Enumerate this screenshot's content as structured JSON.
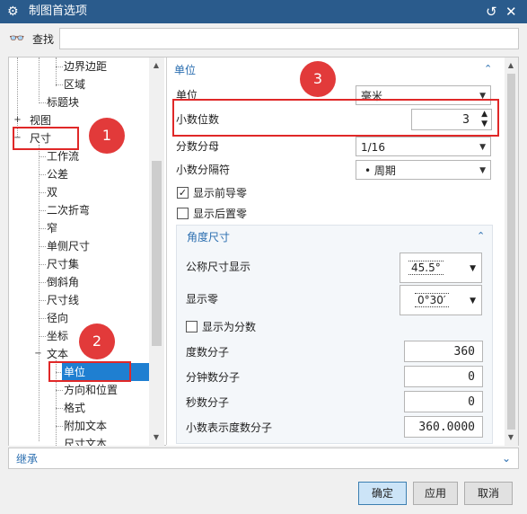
{
  "window": {
    "title": "制图首选项",
    "gear_icon": "gear-icon",
    "reset_icon": "reset-icon",
    "close_icon": "close-icon"
  },
  "find": {
    "label": "查找",
    "value": "",
    "placeholder": ""
  },
  "tree": {
    "items": [
      {
        "label": "边界边距"
      },
      {
        "label": "区域"
      },
      {
        "label": "标题块"
      },
      {
        "label": "视图"
      },
      {
        "label": "尺寸"
      },
      {
        "label": "工作流"
      },
      {
        "label": "公差"
      },
      {
        "label": "双"
      },
      {
        "label": "二次折弯"
      },
      {
        "label": "窄"
      },
      {
        "label": "单侧尺寸"
      },
      {
        "label": "尺寸集"
      },
      {
        "label": "倒斜角"
      },
      {
        "label": "尺寸线"
      },
      {
        "label": "径向"
      },
      {
        "label": "坐标"
      },
      {
        "label": "文本"
      },
      {
        "label": "单位"
      },
      {
        "label": "方向和位置"
      },
      {
        "label": "格式"
      },
      {
        "label": "附加文本"
      },
      {
        "label": "尺寸文本"
      }
    ]
  },
  "units_section": {
    "header": "单位",
    "unit_label": "单位",
    "unit_value": "毫米",
    "decimal_places_label": "小数位数",
    "decimal_places_value": "3",
    "fraction_denominator_label": "分数分母",
    "fraction_denominator_value": "1/16",
    "decimal_separator_label": "小数分隔符",
    "decimal_separator_value": "• 周期",
    "show_leading_zeros_label": "显示前导零",
    "show_leading_zeros_checked": true,
    "show_trailing_zeros_label": "显示后置零",
    "show_trailing_zeros_checked": false
  },
  "angle_section": {
    "header": "角度尺寸",
    "nominal_display_label": "公称尺寸显示",
    "nominal_display_value": "45.5°",
    "show_zero_label": "显示零",
    "show_zero_value": "0°30′",
    "show_as_fraction_label": "显示为分数",
    "show_as_fraction_checked": false,
    "degrees_numerator_label": "度数分子",
    "degrees_numerator_value": "360",
    "minutes_numerator_label": "分钟数分子",
    "minutes_numerator_value": "0",
    "seconds_numerator_label": "秒数分子",
    "seconds_numerator_value": "0",
    "decimal_degrees_numerator_label": "小数表示度数分子",
    "decimal_degrees_numerator_value": "360.0000"
  },
  "inherit": {
    "label": "继承"
  },
  "buttons": {
    "ok": "确定",
    "apply": "应用",
    "cancel": "取消"
  },
  "annotations": {
    "one": "1",
    "two": "2",
    "three": "3"
  },
  "colors": {
    "titlebar": "#2a5b8c",
    "accent": "#2a6eb0",
    "selection": "#1f7fd1",
    "annotation": "#e02828"
  }
}
